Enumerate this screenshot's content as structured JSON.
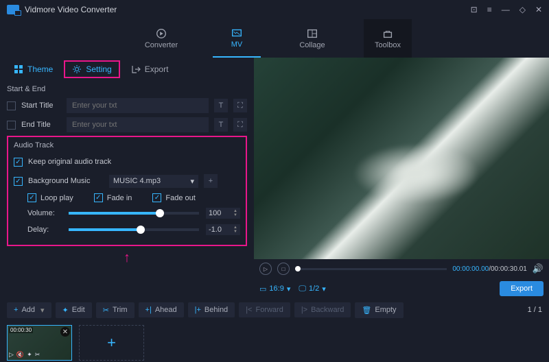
{
  "app_title": "Vidmore Video Converter",
  "nav": {
    "converter": "Converter",
    "mv": "MV",
    "collage": "Collage",
    "toolbox": "Toolbox"
  },
  "subtabs": {
    "theme": "Theme",
    "setting": "Setting",
    "export": "Export"
  },
  "sections": {
    "start_end": "Start & End",
    "audio": "Audio Track"
  },
  "start": {
    "start_title": "Start Title",
    "end_title": "End Title",
    "placeholder": "Enter your txt"
  },
  "audio": {
    "keep": "Keep original audio track",
    "bg": "Background Music",
    "file": "MUSIC 4.mp3",
    "loop": "Loop play",
    "fadein": "Fade in",
    "fadeout": "Fade out",
    "volume_lbl": "Volume:",
    "volume": "100",
    "delay_lbl": "Delay:",
    "delay": "-1.0"
  },
  "preview": {
    "time_cur": "00:00:00.00",
    "time_tot": "00:00:30.01",
    "ratio": "16:9",
    "scale": "1/2"
  },
  "export_btn": "Export",
  "tools": {
    "add": "Add",
    "edit": "Edit",
    "trim": "Trim",
    "ahead": "Ahead",
    "behind": "Behind",
    "forward": "Forward",
    "backward": "Backward",
    "empty": "Empty"
  },
  "pager": "1 / 1",
  "clip": {
    "duration": "00:00:30"
  }
}
